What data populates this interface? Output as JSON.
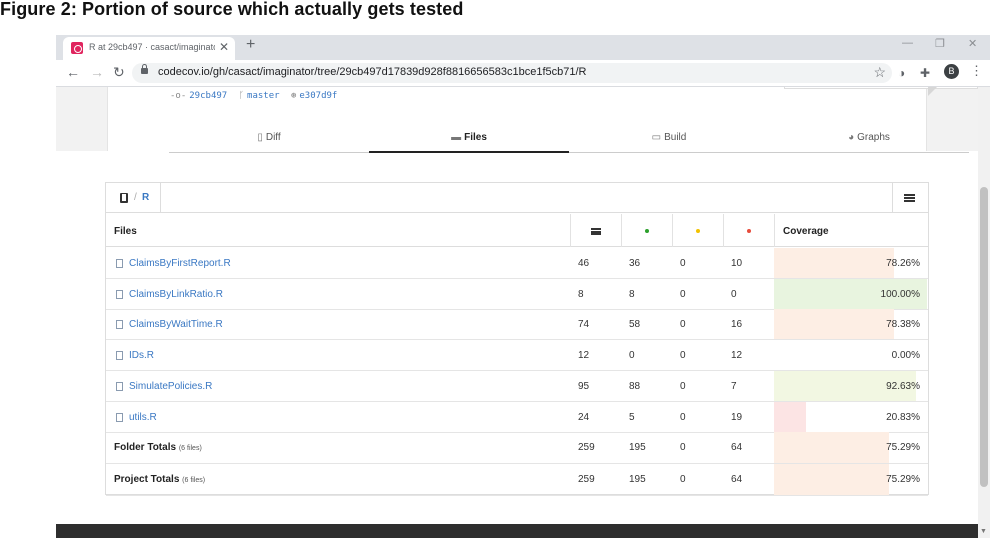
{
  "figure_title": "Figure 2: Portion of source which actually gets tested",
  "browser": {
    "tab_title": "R at 29cb497 · casact/imaginato",
    "tab_close": "✕",
    "new_tab": "+",
    "url": "codecov.io/gh/casact/imaginator/tree/29cb497d17839d928f8816656583c1bce1f5cb71/R",
    "profile_initial": "B",
    "back": "←",
    "forward": "→",
    "reload": "↻",
    "star": "☆",
    "menu": "⋮",
    "minimize": "—",
    "restore": "❐",
    "close": "✕"
  },
  "commit": {
    "hash": "29cb497",
    "branch": "master",
    "parent": "e307d9f",
    "commit_icon": "-o-",
    "branch_icon": "ᚴ",
    "parent_icon": "⊛"
  },
  "tabs": [
    {
      "label": "Diff",
      "icon": "▯"
    },
    {
      "label": "Files",
      "icon": "▬"
    },
    {
      "label": "Build",
      "icon": "▭"
    },
    {
      "label": "Graphs",
      "icon": "◕"
    }
  ],
  "breadcrumb": {
    "separator": "/",
    "folder": "R"
  },
  "table": {
    "header_files": "Files",
    "header_coverage": "Coverage",
    "colors": {
      "hit": "#2ca02c",
      "partial": "#f2c200",
      "miss": "#e74c3c"
    },
    "rows": [
      {
        "file": "ClaimsByFirstReport.R",
        "lines": "46",
        "hits": "36",
        "partials": "0",
        "misses": "10",
        "coverage": "78.26%",
        "cov_value": 78.26,
        "bar_color": "#fdeee4"
      },
      {
        "file": "ClaimsByLinkRatio.R",
        "lines": "8",
        "hits": "8",
        "partials": "0",
        "misses": "0",
        "coverage": "100.00%",
        "cov_value": 100.0,
        "bar_color": "#e8f4df"
      },
      {
        "file": "ClaimsByWaitTime.R",
        "lines": "74",
        "hits": "58",
        "partials": "0",
        "misses": "16",
        "coverage": "78.38%",
        "cov_value": 78.38,
        "bar_color": "#fdeee4"
      },
      {
        "file": "IDs.R",
        "lines": "12",
        "hits": "0",
        "partials": "0",
        "misses": "12",
        "coverage": "0.00%",
        "cov_value": 0.0,
        "bar_color": "#fce4e4"
      },
      {
        "file": "SimulatePolicies.R",
        "lines": "95",
        "hits": "88",
        "partials": "0",
        "misses": "7",
        "coverage": "92.63%",
        "cov_value": 92.63,
        "bar_color": "#f2f7e2"
      },
      {
        "file": "utils.R",
        "lines": "24",
        "hits": "5",
        "partials": "0",
        "misses": "19",
        "coverage": "20.83%",
        "cov_value": 20.83,
        "bar_color": "#fce4e4"
      }
    ],
    "totals": [
      {
        "label": "Folder Totals",
        "count": "(6 files)",
        "lines": "259",
        "hits": "195",
        "partials": "0",
        "misses": "64",
        "coverage": "75.29%",
        "cov_value": 75.29,
        "bar_color": "#fdeee4"
      },
      {
        "label": "Project Totals",
        "count": "(6 files)",
        "lines": "259",
        "hits": "195",
        "partials": "0",
        "misses": "64",
        "coverage": "75.29%",
        "cov_value": 75.29,
        "bar_color": "#fdeee4"
      }
    ]
  }
}
